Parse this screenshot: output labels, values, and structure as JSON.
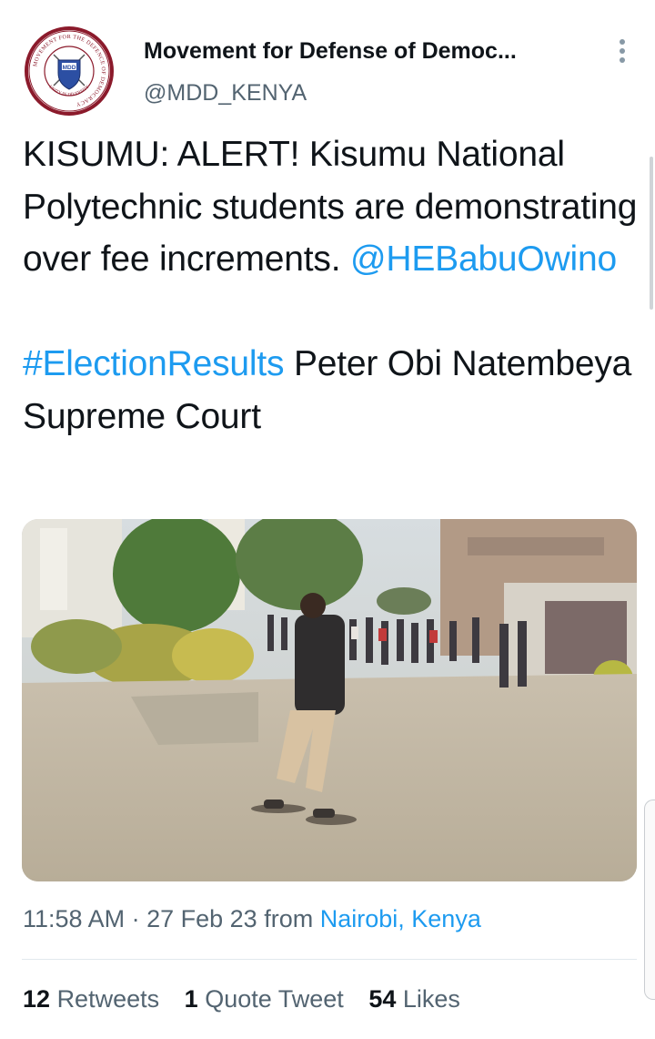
{
  "author": {
    "display_name": "Movement for Defense of Democ...",
    "handle": "@MDD_KENYA",
    "avatar": {
      "ring_text": "MOVEMENT FOR THE DEFENCE OF DEMOCRACY",
      "bottom_text": "UNITY IN DIVERSITY",
      "badge_text": "MDD",
      "ring_color": "#8b1a2b",
      "shield_color": "#2c4fa3"
    }
  },
  "tweet": {
    "line1_text": "KISUMU: ALERT! Kisumu National Polytechnic students are demonstrating over fee increments.",
    "mention": "@HEBabuOwino",
    "hashtag": "#ElectionResults",
    "line2_text": "Peter Obi Natembeya Supreme Court"
  },
  "meta": {
    "time": "11:58 AM",
    "separator": "·",
    "date": "27 Feb 23",
    "from_label": "from",
    "location": "Nairobi, Kenya"
  },
  "stats": {
    "retweets_count": "12",
    "retweets_label": "Retweets",
    "quotes_count": "1",
    "quotes_label": "Quote Tweet",
    "likes_count": "54",
    "likes_label": "Likes"
  },
  "colors": {
    "link": "#1d9bf0",
    "secondary_text": "#536471",
    "primary_text": "#0f1419"
  },
  "icons": {
    "more": "more-vertical-icon"
  }
}
